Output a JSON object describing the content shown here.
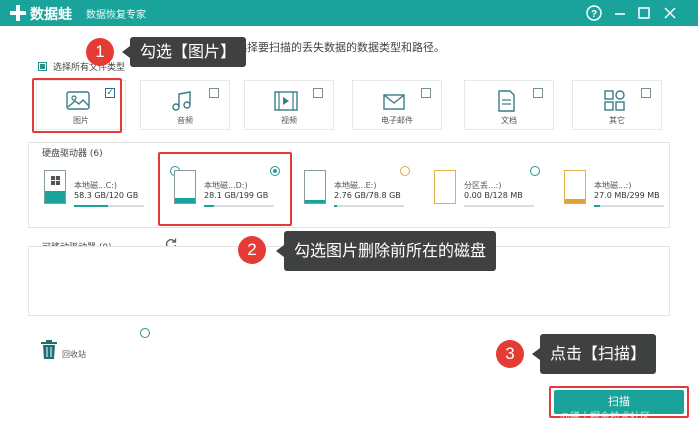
{
  "app": {
    "name": "数据蛙",
    "subtitle": "数据恢复专家"
  },
  "header": {
    "instruction": "选择要扫描的丢失数据的数据类型和路径。",
    "select_all": "选择所有文件类型"
  },
  "file_types": [
    {
      "label": "图片",
      "icon": "image-icon",
      "checked": true
    },
    {
      "label": "音频",
      "icon": "music-icon",
      "checked": false
    },
    {
      "label": "视频",
      "icon": "video-icon",
      "checked": false
    },
    {
      "label": "电子邮件",
      "icon": "mail-icon",
      "checked": false
    },
    {
      "label": "文档",
      "icon": "document-icon",
      "checked": false
    },
    {
      "label": "其它",
      "icon": "others-icon",
      "checked": false
    }
  ],
  "hard_drives": {
    "title": "硬盘驱动器 (6)",
    "disks": [
      {
        "name": "本地磁...C:)",
        "size": "58.3 GB/120 GB",
        "used": 0.486,
        "selected": false
      },
      {
        "name": "本地磁...D:)",
        "size": "28.1 GB/199 GB",
        "used": 0.141,
        "selected": true
      },
      {
        "name": "本地磁...E:)",
        "size": "2.76 GB/78.8 GB",
        "used": 0.035,
        "selected": false
      },
      {
        "name": "分区丢...:)",
        "size": "0.00  B/128 MB",
        "used": 0.0,
        "selected": false
      },
      {
        "name": "本地磁...:)",
        "size": "27.0 MB/299 MB",
        "used": 0.09,
        "selected": false
      }
    ]
  },
  "removable": {
    "title": "可移动驱动器 (0)"
  },
  "recycle": {
    "label": "回收站"
  },
  "scan": {
    "label": "扫描"
  },
  "annotations": [
    {
      "num": "1",
      "text": "勾选【图片】"
    },
    {
      "num": "2",
      "text": "勾选图片删除前所在的磁盘"
    },
    {
      "num": "3",
      "text": "点击【扫描】"
    }
  ],
  "watermark": "@稀土掘金技术社区",
  "colors": {
    "accent": "#1aa39a",
    "annotation_red": "#e63a3a"
  }
}
